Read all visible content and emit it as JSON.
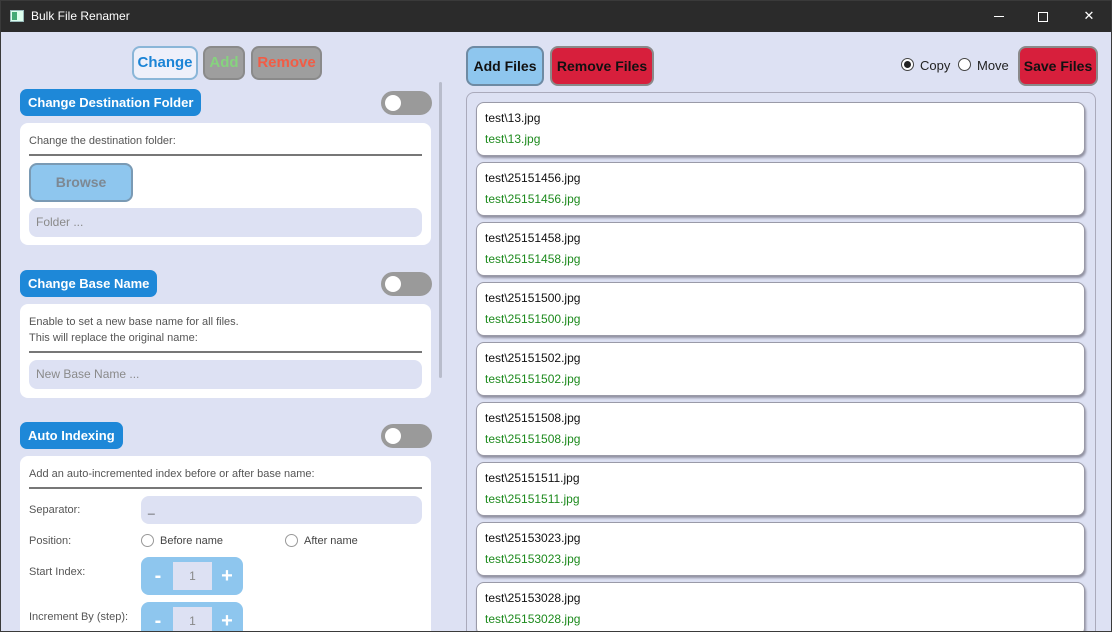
{
  "window": {
    "title": "Bulk File Renamer"
  },
  "mode_tabs": {
    "change": "Change",
    "add": "Add",
    "remove": "Remove"
  },
  "sections": {
    "destination": {
      "title": "Change Destination Folder",
      "description": "Change the destination folder:",
      "browse_label": "Browse",
      "folder_placeholder": "Folder ..."
    },
    "base_name": {
      "title": "Change Base Name",
      "description_line1": "Enable to set a new base name for all files.",
      "description_line2": "This will replace the original name:",
      "placeholder": "New Base Name ..."
    },
    "auto_indexing": {
      "title": "Auto Indexing",
      "description": "Add an auto-incremented index before or after base name:",
      "separator_label": "Separator:",
      "separator_value": "_",
      "position_label": "Position:",
      "position_before": "Before name",
      "position_after": "After name",
      "start_index_label": "Start Index:",
      "start_index_value": "1",
      "increment_label": "Increment By (step):",
      "increment_value": "1",
      "minus": "-",
      "plus": "+"
    }
  },
  "toolbar": {
    "add_files": "Add Files",
    "remove_files": "Remove Files",
    "copy_label": "Copy",
    "move_label": "Move",
    "selected_mode": "Copy",
    "save_files": "Save Files"
  },
  "files": [
    {
      "source": "test\\13.jpg",
      "target": "test\\13.jpg"
    },
    {
      "source": "test\\25151456.jpg",
      "target": "test\\25151456.jpg"
    },
    {
      "source": "test\\25151458.jpg",
      "target": "test\\25151458.jpg"
    },
    {
      "source": "test\\25151500.jpg",
      "target": "test\\25151500.jpg"
    },
    {
      "source": "test\\25151502.jpg",
      "target": "test\\25151502.jpg"
    },
    {
      "source": "test\\25151508.jpg",
      "target": "test\\25151508.jpg"
    },
    {
      "source": "test\\25151511.jpg",
      "target": "test\\25151511.jpg"
    },
    {
      "source": "test\\25153023.jpg",
      "target": "test\\25153023.jpg"
    },
    {
      "source": "test\\25153028.jpg",
      "target": "test\\25153028.jpg"
    }
  ],
  "colors": {
    "background": "#dde1f3",
    "accent_blue": "#1e88d8",
    "light_blue": "#8ec6ee",
    "danger_red": "#d71f3c",
    "target_green": "#1d8a1d"
  }
}
